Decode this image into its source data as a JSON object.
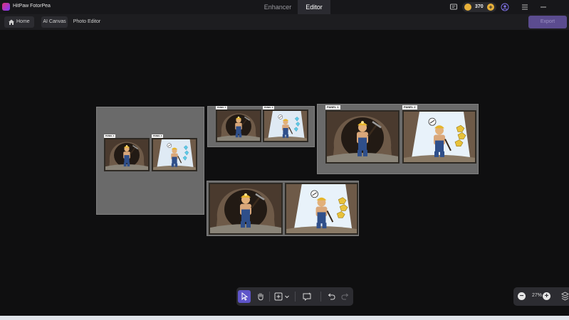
{
  "app": {
    "name": "HitPaw FotorPea"
  },
  "tabs": [
    {
      "label": "Enhancer"
    },
    {
      "label": "Editor"
    }
  ],
  "account": {
    "coins": "370"
  },
  "toolbar": {
    "home_label": "Home",
    "ai_canvas_label": "AI Canvas",
    "photo_editor_label": "Photo Editor",
    "export_label": "Export"
  },
  "boards": {
    "board1": {
      "panel1_label": "PANEL 1",
      "panel2_label": "PANEL 2"
    },
    "board2": {
      "panel1_label": "PANEL 1",
      "panel2_label": "PANEL 2"
    },
    "board3": {
      "panel1_label": "PANEL 1",
      "panel2_label": "PANEL 2"
    }
  },
  "zoom": {
    "value": "27%"
  },
  "icons": {
    "title_bar": [
      "app-logo-icon",
      "chat-icon",
      "coin-icon",
      "add-coins-icon",
      "user-icon",
      "menu-icon",
      "minimize-icon"
    ],
    "bottom_toolbar": [
      "select-icon",
      "hand-icon",
      "add-icon",
      "chevron-down-icon",
      "ai-chat-icon",
      "undo-icon",
      "redo-icon"
    ],
    "zoom": [
      "zoom-out-icon",
      "zoom-in-icon",
      "layers-icon"
    ]
  },
  "colors": {
    "accent": "#5e54c9",
    "coin": "#e8b13a",
    "export_button": "#5b4c8f"
  }
}
